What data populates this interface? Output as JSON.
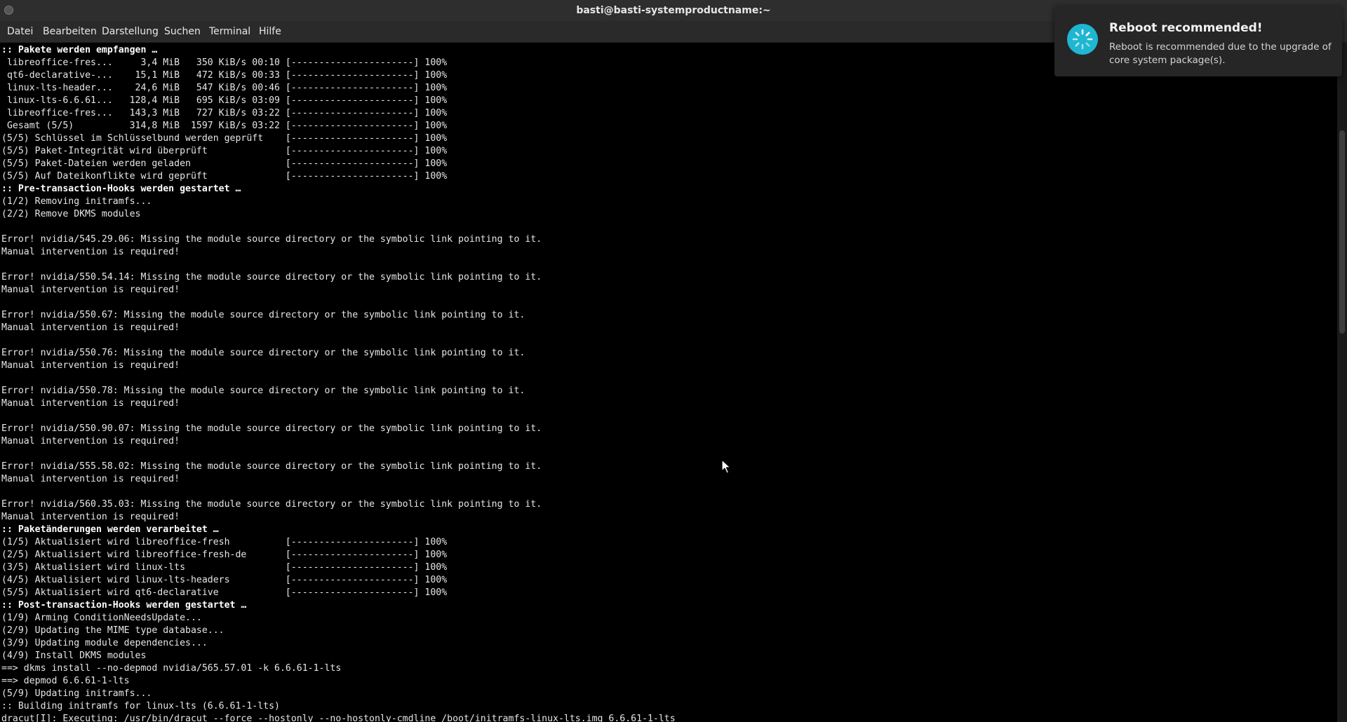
{
  "window": {
    "title": "basti@basti-systemproductname:~"
  },
  "menu": {
    "items": [
      "Datei",
      "Bearbeiten",
      "Darstellung",
      "Suchen",
      "Terminal",
      "Hilfe"
    ]
  },
  "notification": {
    "title": "Reboot recommended!",
    "body": "Reboot is recommended due to the upgrade of core system package(s).",
    "icon": "loading-spinner-icon",
    "accent_color": "#1fb6d1"
  },
  "terminal": {
    "lines": [
      {
        "text": ":: Pakete werden empfangen …",
        "bold": true
      },
      {
        "text": " libreoffice-fres...     3,4 MiB   350 KiB/s 00:10 [----------------------] 100%"
      },
      {
        "text": " qt6-declarative-...    15,1 MiB   472 KiB/s 00:33 [----------------------] 100%"
      },
      {
        "text": " linux-lts-header...    24,6 MiB   547 KiB/s 00:46 [----------------------] 100%"
      },
      {
        "text": " linux-lts-6.6.61...   128,4 MiB   695 KiB/s 03:09 [----------------------] 100%"
      },
      {
        "text": " libreoffice-fres...   143,3 MiB   727 KiB/s 03:22 [----------------------] 100%"
      },
      {
        "text": " Gesamt (5/5)          314,8 MiB  1597 KiB/s 03:22 [----------------------] 100%"
      },
      {
        "text": "(5/5) Schlüssel im Schlüsselbund werden geprüft    [----------------------] 100%"
      },
      {
        "text": "(5/5) Paket-Integrität wird überprüft              [----------------------] 100%"
      },
      {
        "text": "(5/5) Paket-Dateien werden geladen                 [----------------------] 100%"
      },
      {
        "text": "(5/5) Auf Dateikonflikte wird geprüft              [----------------------] 100%"
      },
      {
        "text": ":: Pre-transaction-Hooks werden gestartet …",
        "bold": true
      },
      {
        "text": "(1/2) Removing initramfs..."
      },
      {
        "text": "(2/2) Remove DKMS modules"
      },
      {
        "text": ""
      },
      {
        "text": "Error! nvidia/545.29.06: Missing the module source directory or the symbolic link pointing to it."
      },
      {
        "text": "Manual intervention is required!"
      },
      {
        "text": ""
      },
      {
        "text": "Error! nvidia/550.54.14: Missing the module source directory or the symbolic link pointing to it."
      },
      {
        "text": "Manual intervention is required!"
      },
      {
        "text": ""
      },
      {
        "text": "Error! nvidia/550.67: Missing the module source directory or the symbolic link pointing to it."
      },
      {
        "text": "Manual intervention is required!"
      },
      {
        "text": ""
      },
      {
        "text": "Error! nvidia/550.76: Missing the module source directory or the symbolic link pointing to it."
      },
      {
        "text": "Manual intervention is required!"
      },
      {
        "text": ""
      },
      {
        "text": "Error! nvidia/550.78: Missing the module source directory or the symbolic link pointing to it."
      },
      {
        "text": "Manual intervention is required!"
      },
      {
        "text": ""
      },
      {
        "text": "Error! nvidia/550.90.07: Missing the module source directory or the symbolic link pointing to it."
      },
      {
        "text": "Manual intervention is required!"
      },
      {
        "text": ""
      },
      {
        "text": "Error! nvidia/555.58.02: Missing the module source directory or the symbolic link pointing to it."
      },
      {
        "text": "Manual intervention is required!"
      },
      {
        "text": ""
      },
      {
        "text": "Error! nvidia/560.35.03: Missing the module source directory or the symbolic link pointing to it."
      },
      {
        "text": "Manual intervention is required!"
      },
      {
        "text": ":: Paketänderungen werden verarbeitet …",
        "bold": true
      },
      {
        "text": "(1/5) Aktualisiert wird libreoffice-fresh          [----------------------] 100%"
      },
      {
        "text": "(2/5) Aktualisiert wird libreoffice-fresh-de       [----------------------] 100%"
      },
      {
        "text": "(3/5) Aktualisiert wird linux-lts                  [----------------------] 100%"
      },
      {
        "text": "(4/5) Aktualisiert wird linux-lts-headers          [----------------------] 100%"
      },
      {
        "text": "(5/5) Aktualisiert wird qt6-declarative            [----------------------] 100%"
      },
      {
        "text": ":: Post-transaction-Hooks werden gestartet …",
        "bold": true
      },
      {
        "text": "(1/9) Arming ConditionNeedsUpdate..."
      },
      {
        "text": "(2/9) Updating the MIME type database..."
      },
      {
        "text": "(3/9) Updating module dependencies..."
      },
      {
        "text": "(4/9) Install DKMS modules"
      },
      {
        "text": "==> dkms install --no-depmod nvidia/565.57.01 -k 6.6.61-1-lts"
      },
      {
        "text": "==> depmod 6.6.61-1-lts"
      },
      {
        "text": "(5/9) Updating initramfs..."
      },
      {
        "text": ":: Building initramfs for linux-lts (6.6.61-1-lts)"
      },
      {
        "text": "dracut[I]: Executing: /usr/bin/dracut --force --hostonly --no-hostonly-cmdline /boot/initramfs-linux-lts.img 6.6.61-1-lts"
      }
    ]
  }
}
